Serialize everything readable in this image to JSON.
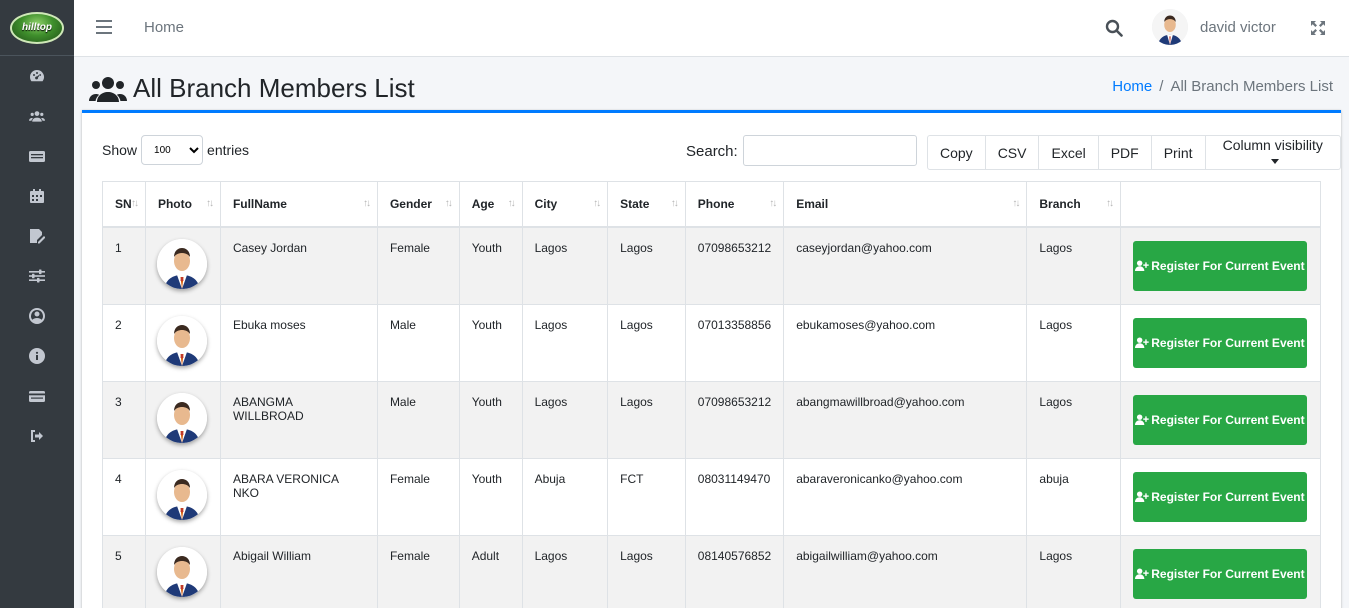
{
  "app": {
    "logo_text": "hilltop"
  },
  "topbar": {
    "home": "Home",
    "user_name": "david victor"
  },
  "page": {
    "title": "All Branch Members List"
  },
  "breadcrumb": {
    "home": "Home",
    "separator": "/",
    "current": "All Branch Members List"
  },
  "toolbar": {
    "show_label": "Show",
    "entries_value": "100",
    "entries_label": "entries",
    "search_label": "Search:",
    "buttons": [
      "Copy",
      "CSV",
      "Excel",
      "PDF",
      "Print",
      "Column visibility"
    ]
  },
  "table": {
    "columns": [
      "SN",
      "Photo",
      "FullName",
      "Gender",
      "Age",
      "City",
      "State",
      "Phone",
      "Email",
      "Branch",
      ""
    ],
    "register_label": "Register For Current Event",
    "rows": [
      {
        "sn": "1",
        "name": "Casey Jordan",
        "gender": "Female",
        "age": "Youth",
        "city": "Lagos",
        "state": "Lagos",
        "phone": "07098653212",
        "email": "caseyjordan@yahoo.com",
        "branch": "Lagos"
      },
      {
        "sn": "2",
        "name": "Ebuka moses",
        "gender": "Male",
        "age": "Youth",
        "city": "Lagos",
        "state": "Lagos",
        "phone": "07013358856",
        "email": "ebukamoses@yahoo.com",
        "branch": "Lagos"
      },
      {
        "sn": "3",
        "name": "ABANGMA WILLBROAD",
        "gender": "Male",
        "age": "Youth",
        "city": "Lagos",
        "state": "Lagos",
        "phone": "07098653212",
        "email": "abangmawillbroad@yahoo.com",
        "branch": "Lagos"
      },
      {
        "sn": "4",
        "name": "ABARA VERONICA NKO",
        "gender": "Female",
        "age": "Youth",
        "city": "Abuja",
        "state": "FCT",
        "phone": "08031149470",
        "email": "abaraveronicanko@yahoo.com",
        "branch": "abuja"
      },
      {
        "sn": "5",
        "name": "Abigail William",
        "gender": "Female",
        "age": "Adult",
        "city": "Lagos",
        "state": "Lagos",
        "phone": "08140576852",
        "email": "abigailwilliam@yahoo.com",
        "branch": "Lagos"
      }
    ]
  },
  "icons": [
    "dashboard-icon",
    "users-icon",
    "list-icon",
    "calendar-icon",
    "edit-icon",
    "sliders-icon",
    "user-circle-icon",
    "info-icon",
    "card-icon",
    "logout-icon"
  ],
  "colors": {
    "sidebar": "#343a40",
    "accent": "#007bff",
    "success": "#28a745"
  }
}
